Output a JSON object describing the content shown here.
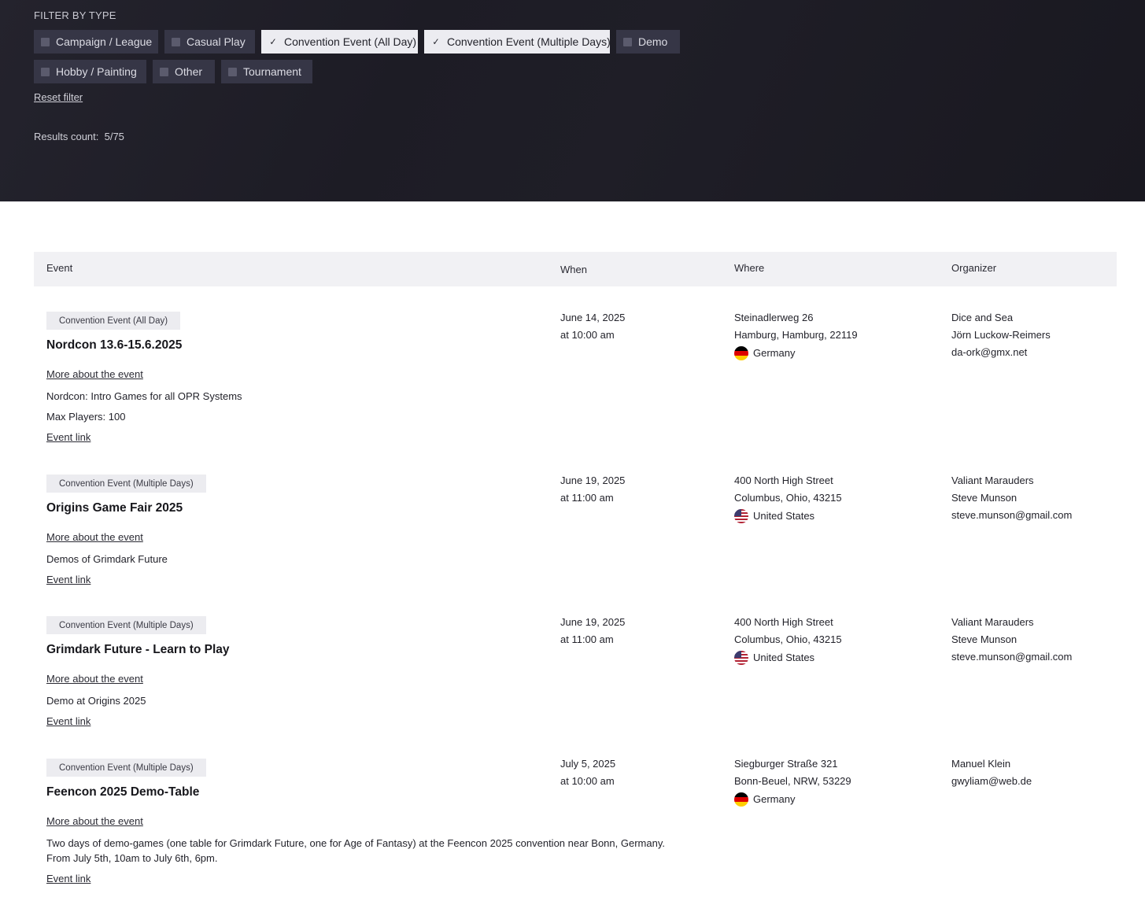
{
  "filter": {
    "title": "FILTER BY TYPE",
    "options": [
      {
        "label": "Campaign / League",
        "checked": false
      },
      {
        "label": "Casual Play",
        "checked": false
      },
      {
        "label": "Convention Event (All Day)",
        "checked": true
      },
      {
        "label": "Convention Event (Multiple Days)",
        "checked": true
      },
      {
        "label": "Demo",
        "checked": false
      },
      {
        "label": "Hobby / Painting",
        "checked": false
      },
      {
        "label": "Other",
        "checked": false
      },
      {
        "label": "Tournament",
        "checked": false
      }
    ],
    "reset_label": "Reset filter",
    "results_label": "Results count:",
    "results_value": "5/75"
  },
  "table": {
    "headers": {
      "event": "Event",
      "when": "When",
      "where": "Where",
      "organizer": "Organizer"
    },
    "more_label": "More about the event",
    "event_link_label": "Event link",
    "rows": [
      {
        "type": "Convention Event (All Day)",
        "title": "Nordcon 13.6-15.6.2025",
        "desc": [
          "Nordcon: Intro Games for all OPR Systems",
          "Max Players: 100"
        ],
        "date": "June 14, 2025",
        "time": "at 10:00 am",
        "street": "Steinadlerweg 26",
        "city": "Hamburg, Hamburg, 22119",
        "country": "Germany",
        "flag": "germany-flag-icon",
        "organizer": [
          "Dice and Sea",
          "Jörn Luckow-Reimers",
          "da-ork@gmx.net"
        ]
      },
      {
        "type": "Convention Event (Multiple Days)",
        "title": "Origins Game Fair 2025",
        "desc": [
          "Demos of Grimdark Future"
        ],
        "date": "June 19, 2025",
        "time": "at 11:00 am",
        "street": "400 North High Street",
        "city": "Columbus, Ohio, 43215",
        "country": "United States",
        "flag": "united-states-flag-icon",
        "organizer": [
          "Valiant Marauders",
          "Steve Munson",
          "steve.munson@gmail.com"
        ]
      },
      {
        "type": "Convention Event (Multiple Days)",
        "title": "Grimdark Future - Learn to Play",
        "desc": [
          "Demo at Origins 2025"
        ],
        "date": "June 19, 2025",
        "time": "at 11:00 am",
        "street": "400 North High Street",
        "city": "Columbus, Ohio, 43215",
        "country": "United States",
        "flag": "united-states-flag-icon",
        "organizer": [
          "Valiant Marauders",
          "Steve Munson",
          "steve.munson@gmail.com"
        ]
      },
      {
        "type": "Convention Event (Multiple Days)",
        "title": "Feencon 2025 Demo-Table",
        "desc": [
          "Two days of demo-games (one table for Grimdark Future, one for Age of Fantasy) at the Feencon 2025 convention near Bonn, Germany.",
          "From July 5th, 10am to July 6th, 6pm."
        ],
        "date": "July 5, 2025",
        "time": "at 10:00 am",
        "street": "Siegburger Straße 321",
        "city": "Bonn-Beuel, NRW, 53229",
        "country": "Germany",
        "flag": "germany-flag-icon",
        "organizer": [
          "Manuel Klein",
          "gwyliam@web.de"
        ]
      }
    ]
  }
}
